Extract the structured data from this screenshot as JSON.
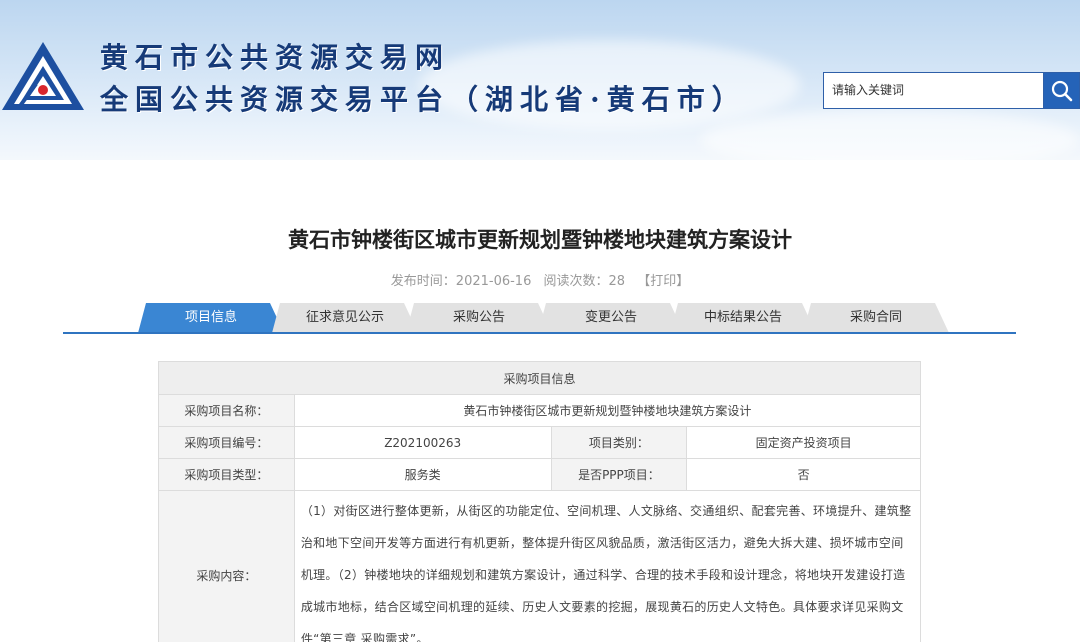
{
  "header": {
    "title_line1": "黄石市公共资源交易网",
    "title_line2": "全国公共资源交易平台（湖北省·黄石市）",
    "logo_icon": "triangle-logo-icon"
  },
  "search": {
    "placeholder": "请输入关键词",
    "button_icon": "search-icon"
  },
  "article": {
    "title": "黄石市钟楼街区城市更新规划暨钟楼地块建筑方案设计",
    "publish_label": "发布时间：2021-06-16",
    "views_label": "阅读次数：28",
    "print_label": "【打印】"
  },
  "tabs": [
    {
      "label": "项目信息",
      "active": true
    },
    {
      "label": "征求意见公示",
      "active": false
    },
    {
      "label": "采购公告",
      "active": false
    },
    {
      "label": "变更公告",
      "active": false
    },
    {
      "label": "中标结果公告",
      "active": false
    },
    {
      "label": "采购合同",
      "active": false
    }
  ],
  "table": {
    "header": "采购项目信息",
    "name_label": "采购项目名称：",
    "name_value": "黄石市钟楼街区城市更新规划暨钟楼地块建筑方案设计",
    "code_label": "采购项目编号：",
    "code_value": "Z202100263",
    "category_label": "项目类别：",
    "category_value": "固定资产投资项目",
    "type_label": "采购项目类型：",
    "type_value": "服务类",
    "ppp_label": "是否PPP项目：",
    "ppp_value": "否",
    "content_label": "采购内容：",
    "content_value": "（1）对街区进行整体更新，从街区的功能定位、空间机理、人文脉络、交通组织、配套完善、环境提升、建筑整治和地下空间开发等方面进行有机更新，整体提升街区风貌品质，激活街区活力，避免大拆大建、损坏城市空间机理。（2）钟楼地块的详细规划和建筑方案设计，通过科学、合理的技术手段和设计理念，将地块开发建设打造成城市地标，结合区域空间机理的延续、历史人文要素的挖掘，展现黄石的历史人文特色。具体要求详见采购文件“第三章 采购需求”。"
  },
  "colors": {
    "accent": "#2f74c0",
    "title_blue": "#163a78",
    "tab_inactive": "#e2e2e2"
  }
}
